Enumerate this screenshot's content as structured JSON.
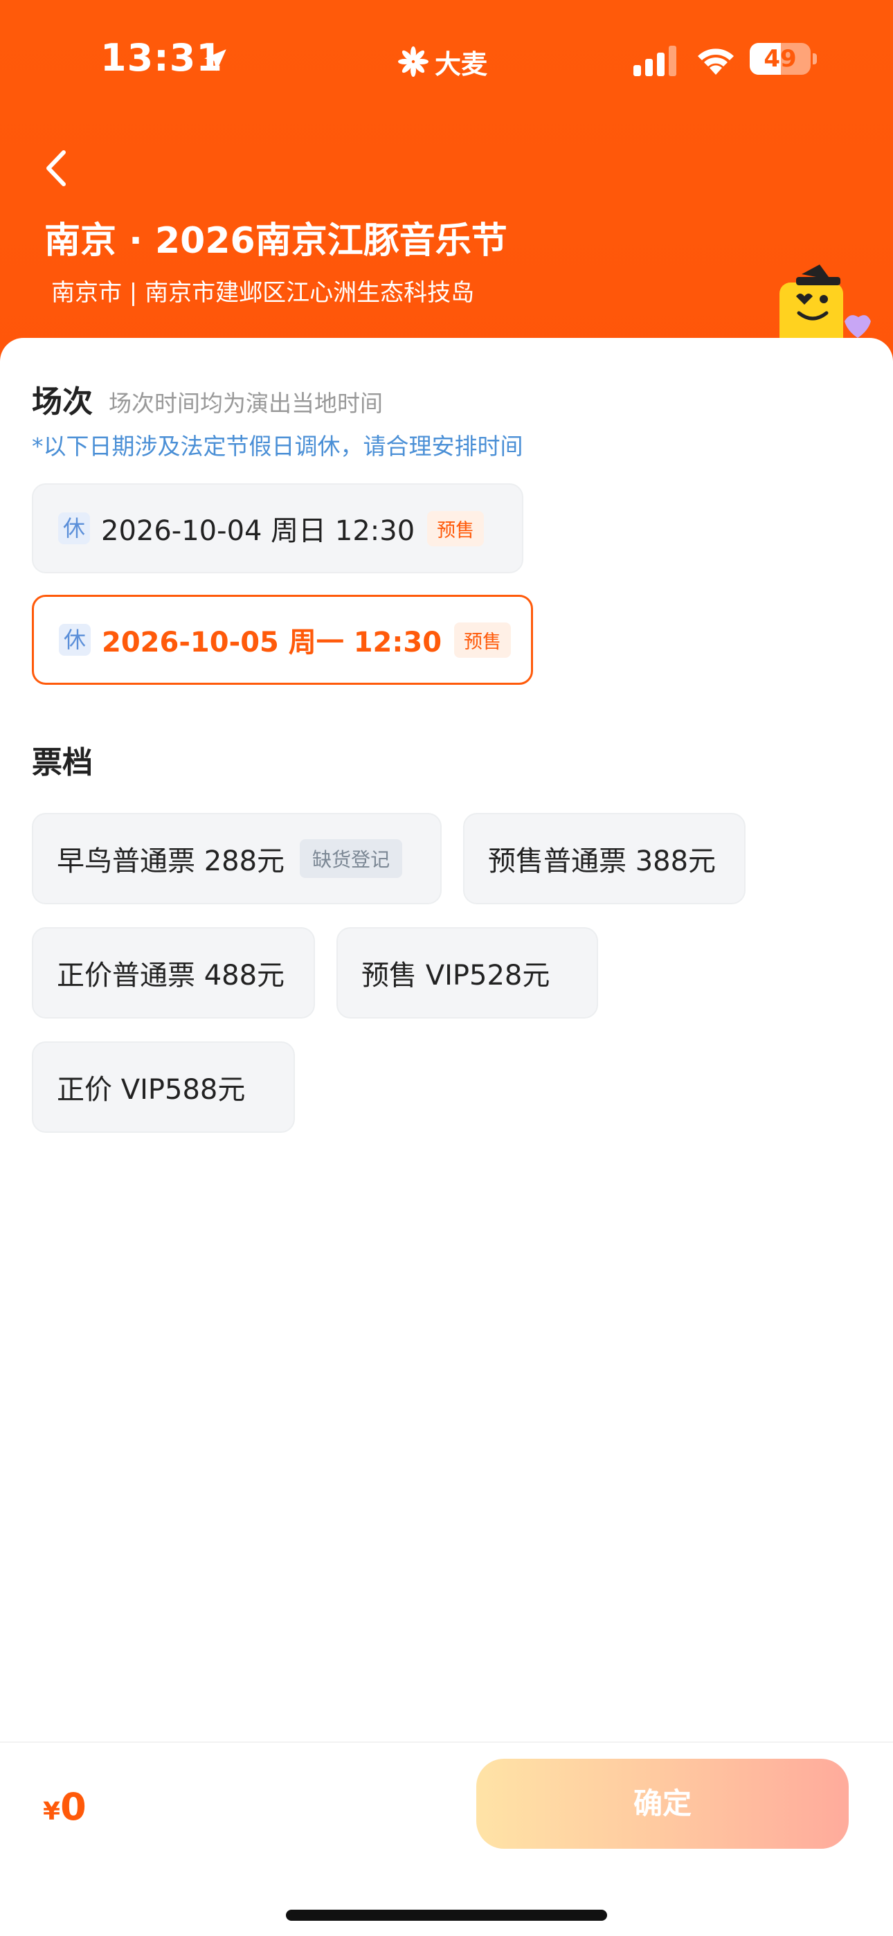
{
  "status_bar": {
    "time": "13:31",
    "brand": "大麦",
    "battery": "49"
  },
  "header": {
    "title": "南京 · 2026南京江豚音乐节",
    "subtitle": "南京市 | 南京市建邺区江心洲生态科技岛"
  },
  "sessions_section": {
    "title": "场次",
    "hint": "场次时间均为演出当地时间",
    "notice": "*以下日期涉及法定节假日调休，请合理安排时间",
    "items": [
      {
        "rest": "休",
        "datetime": "2026-10-04 周日 12:30",
        "tag": "预售",
        "selected": false
      },
      {
        "rest": "休",
        "datetime": "2026-10-05 周一 12:30",
        "tag": "预售",
        "selected": true
      }
    ]
  },
  "tickets_section": {
    "title": "票档",
    "items": [
      {
        "label": "早鸟普通票 288元",
        "badge": "缺货登记"
      },
      {
        "label": "预售普通票 388元"
      },
      {
        "label": "正价普通票 488元"
      },
      {
        "label": "预售 VIP528元"
      },
      {
        "label": "正价 VIP588元"
      }
    ]
  },
  "footer": {
    "currency": "¥",
    "amount": "0",
    "confirm_label": "确定"
  },
  "colors": {
    "brand": "#ff5a0a",
    "notice": "#4a8fd6"
  }
}
